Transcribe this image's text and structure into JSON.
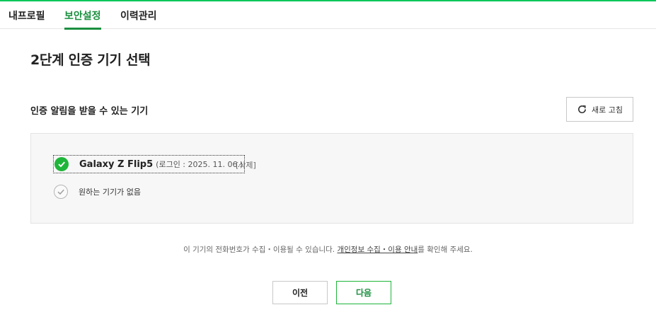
{
  "tabs": [
    {
      "label": "내프로필",
      "active": false
    },
    {
      "label": "보안설정",
      "active": true
    },
    {
      "label": "이력관리",
      "active": false
    }
  ],
  "page_title": "2단계 인증 기기 선택",
  "section": {
    "title": "인증 알림을 받을 수 있는 기기",
    "refresh_label": "새로 고침",
    "refresh_icon": "refresh-icon"
  },
  "devices": [
    {
      "name": "Galaxy Z Flip5",
      "login": "(로그인 : 2025. 11. 06.)",
      "delete_label": "[삭제]",
      "selected": true
    },
    {
      "label": "원하는 기기가 없음",
      "selected": false
    }
  ],
  "notice": {
    "prefix": "이 기기의 전화번호가 수집・이용될 수 있습니다. ",
    "link": "개인정보 수집・이용 안내",
    "suffix": "를 확인해 주세요."
  },
  "buttons": {
    "prev": "이전",
    "next": "다음"
  },
  "colors": {
    "accent": "#1a8f3f",
    "check_green": "#1fb53a",
    "top_line": "#03c75a"
  }
}
